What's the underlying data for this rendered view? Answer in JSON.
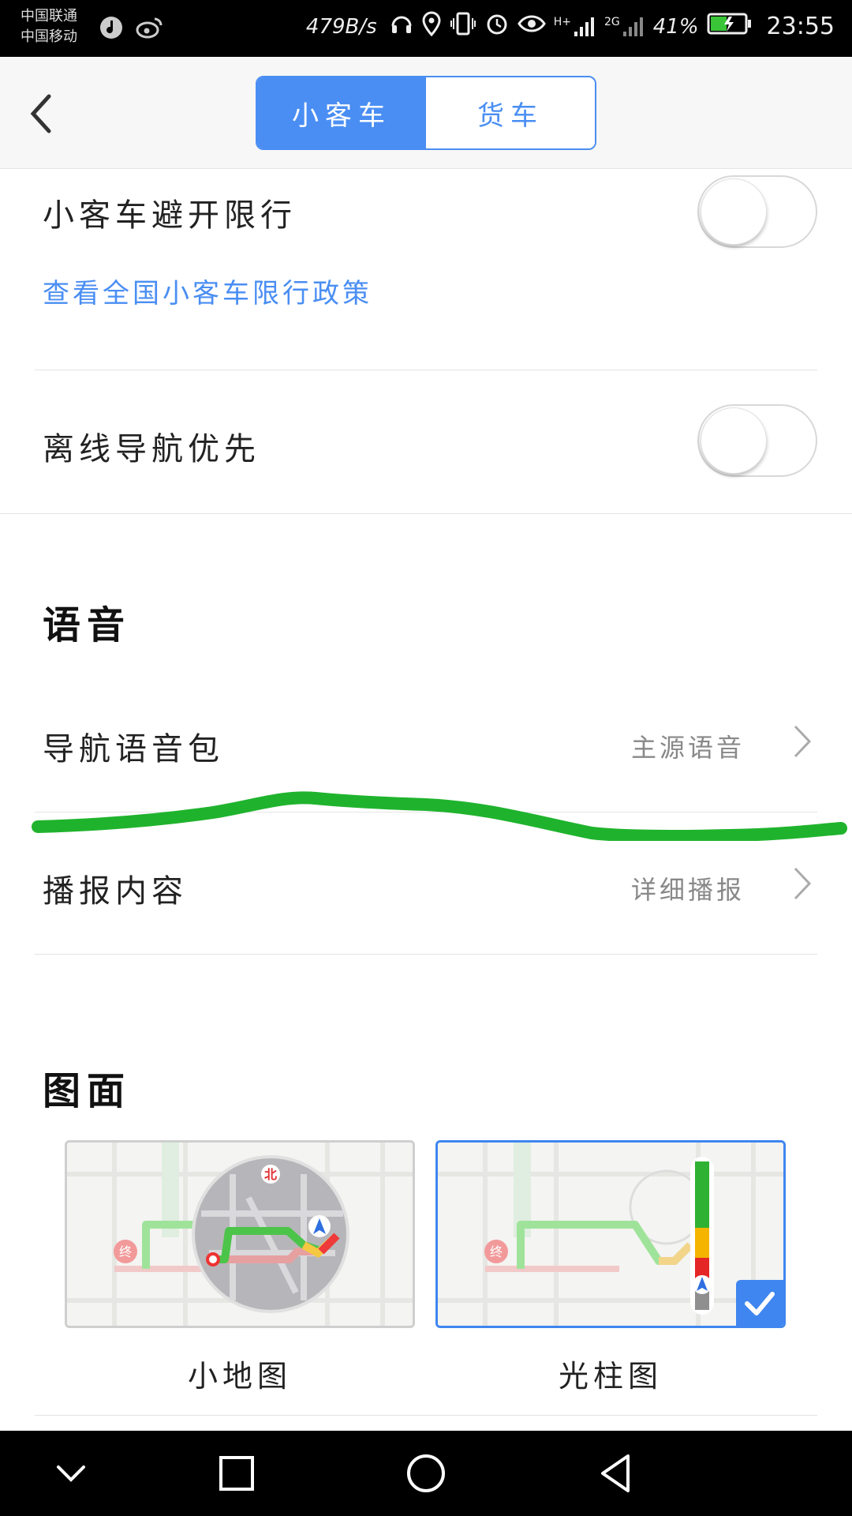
{
  "status_bar": {
    "carrier1": "中国联通",
    "carrier2": "中国移动",
    "net_speed": "479B/s",
    "net_type1": "H+",
    "net_type2": "2G",
    "battery": "41%",
    "time": "23:55"
  },
  "header": {
    "tabs": [
      {
        "label": "小客车",
        "active": true
      },
      {
        "label": "货车",
        "active": false
      }
    ]
  },
  "settings": {
    "avoid_restriction": {
      "label": "小客车避开限行",
      "link": "查看全国小客车限行政策",
      "enabled": false
    },
    "offline_priority": {
      "label": "离线导航优先",
      "enabled": false
    }
  },
  "voice": {
    "heading": "语音",
    "voice_pack": {
      "label": "导航语音包",
      "value": "主源语音"
    },
    "broadcast": {
      "label": "播报内容",
      "value": "详细播报"
    }
  },
  "display": {
    "heading": "图面",
    "options": [
      {
        "label": "小地图",
        "selected": false,
        "end_marker": "终",
        "north": "北"
      },
      {
        "label": "光柱图",
        "selected": true,
        "end_marker": "终"
      }
    ]
  },
  "colors": {
    "accent": "#4a8ef3",
    "annotation_stroke": "#1fb32d"
  }
}
